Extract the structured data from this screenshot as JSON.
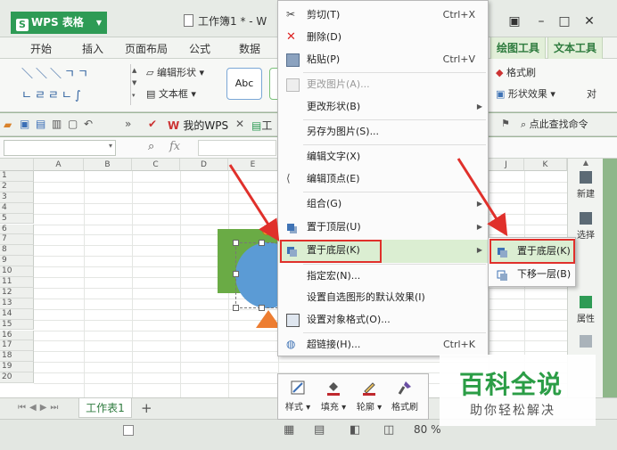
{
  "app": {
    "logo_text": "WPS 表格",
    "logo_mark": "S",
    "doc_title": "工作簿1 * - W"
  },
  "ribbon_tabs": [
    "开始",
    "插入",
    "页面布局",
    "公式",
    "数据"
  ],
  "context_tabs": [
    "绘图工具",
    "文本工具"
  ],
  "ribbon": {
    "edit_shape": "编辑形状",
    "textbox": "文本框",
    "style_label": "Abc",
    "format_painter": "格式刷",
    "shape_effect": "形状效果",
    "align_partial": "对"
  },
  "qat": {
    "mywps": "我的WPS",
    "tab_partial": "工",
    "find_command": "点此查找命令"
  },
  "formula_bar": {
    "fx": "fx"
  },
  "grid": {
    "columns": [
      "A",
      "B",
      "C",
      "D",
      "E",
      "J",
      "K"
    ],
    "rows": [
      "1",
      "2",
      "3",
      "4",
      "5",
      "6",
      "7",
      "8",
      "9",
      "10",
      "11",
      "12",
      "13",
      "14",
      "15",
      "16",
      "17",
      "18",
      "19",
      "20"
    ]
  },
  "right_panel": {
    "new": "新建",
    "select": "选择",
    "properties": "属性"
  },
  "sheet_tab": "工作表1",
  "add_sheet": "+",
  "status": {
    "zoom": "80 %"
  },
  "context_menu": {
    "items": [
      {
        "label": "剪切(T)",
        "shortcut": "Ctrl+X"
      },
      {
        "label": "删除(D)",
        "shortcut": ""
      },
      {
        "label": "粘贴(P)",
        "shortcut": "Ctrl+V"
      },
      {
        "label": "更改图片(A)...",
        "shortcut": ""
      },
      {
        "label": "更改形状(B)",
        "shortcut": ""
      },
      {
        "label": "另存为图片(S)...",
        "shortcut": ""
      },
      {
        "label": "编辑文字(X)",
        "shortcut": ""
      },
      {
        "label": "编辑顶点(E)",
        "shortcut": ""
      },
      {
        "label": "组合(G)",
        "shortcut": ""
      },
      {
        "label": "置于顶层(U)",
        "shortcut": ""
      },
      {
        "label": "置于底层(K)",
        "shortcut": ""
      },
      {
        "label": "指定宏(N)...",
        "shortcut": ""
      },
      {
        "label": "设置自选图形的默认效果(I)",
        "shortcut": ""
      },
      {
        "label": "设置对象格式(O)...",
        "shortcut": ""
      },
      {
        "label": "超链接(H)...",
        "shortcut": "Ctrl+K"
      }
    ]
  },
  "submenu": {
    "items": [
      "置于底层(K)",
      "下移一层(B)"
    ]
  },
  "draw_tools": [
    "样式",
    "填充",
    "轮廓",
    "格式刷"
  ],
  "watermark": {
    "title": "百科全说",
    "subtitle": "助你轻松解决"
  },
  "colors": {
    "accent_green": "#2e9b55",
    "highlight_red": "#e0302b",
    "shape_green": "#6aab45",
    "shape_blue": "#5b9bd5",
    "shape_orange": "#ed7d31"
  }
}
